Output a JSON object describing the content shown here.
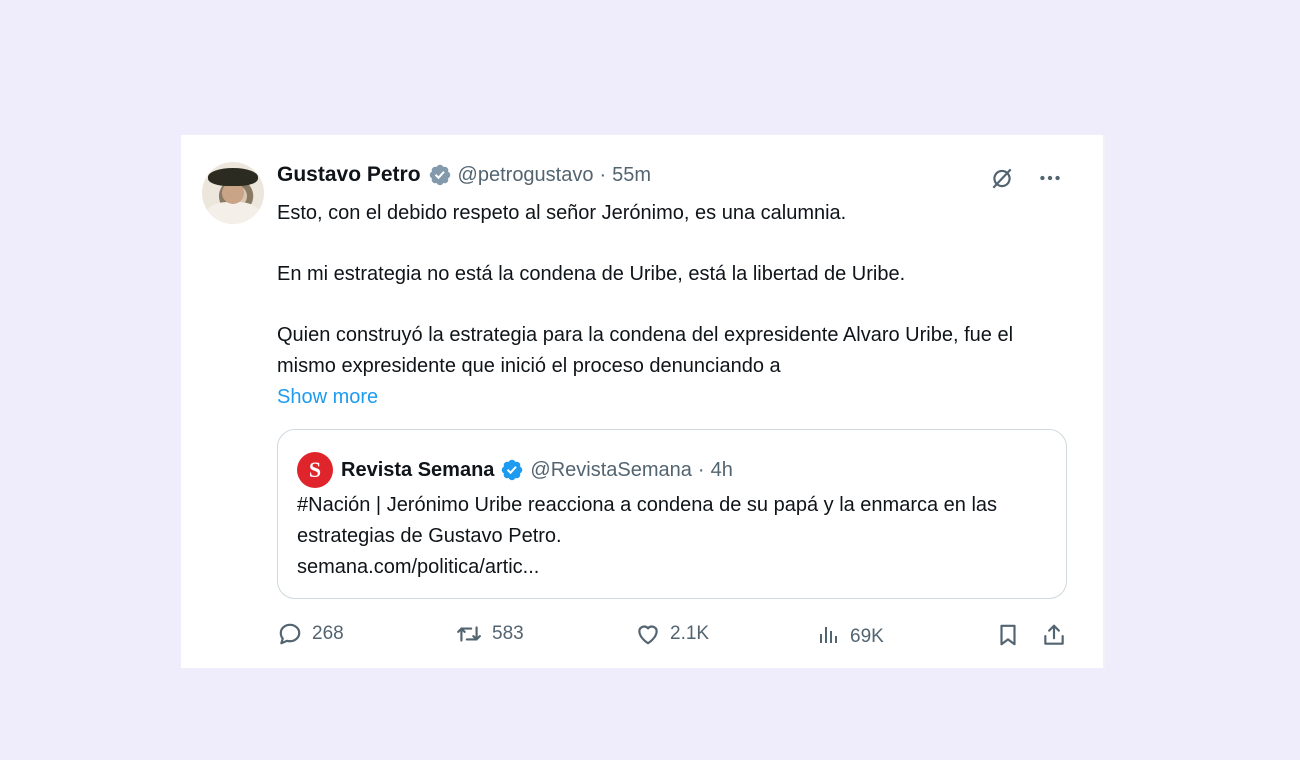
{
  "tweet": {
    "author": {
      "name": "Gustavo Petro",
      "handle": "@petrogustavo",
      "separator": "·",
      "time": "55m"
    },
    "paragraphs": [
      "Esto, con el debido respeto al señor Jerónimo, es una calumnia.",
      "En mi estrategia no está la condena de Uribe, está la libertad de Uribe.",
      "Quien construyó la estrategia para la condena del expresidente Alvaro Uribe, fue el mismo expresidente que inició el proceso denunciando a"
    ],
    "show_more": "Show more",
    "top_icons": [
      "grok-icon",
      "more-icon"
    ]
  },
  "quote": {
    "logo_letter": "S",
    "name": "Revista Semana",
    "handle": "@RevistaSemana",
    "separator": "·",
    "time": "4h",
    "text": "#Nación | Jerónimo Uribe reacciona a condena de su papá y la enmarca en las estrategias de Gustavo Petro.",
    "link": "semana.com/politica/artic..."
  },
  "stats": {
    "replies": "268",
    "reposts": "583",
    "likes": "2.1K",
    "views": "69K"
  },
  "colors": {
    "page_background": "#efedfc",
    "card": "#ffffff",
    "accent": "#1d9bf0",
    "verified_petro": "#829aab",
    "verified_semana": "#1d9bf0",
    "semana_logo": "#e0242b",
    "muted_text": "#536471"
  }
}
